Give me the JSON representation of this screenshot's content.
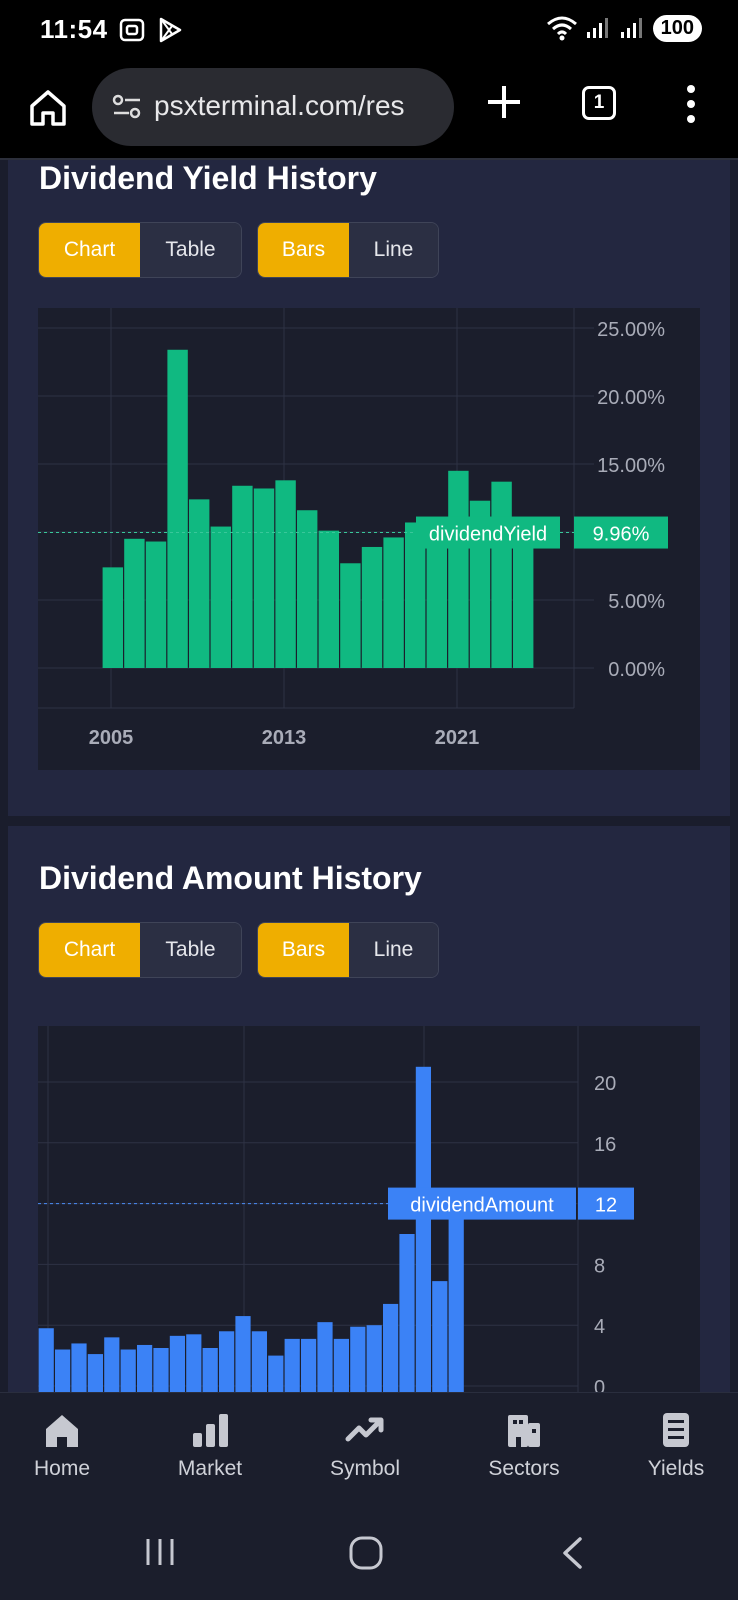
{
  "status": {
    "time": "11:54",
    "battery": "100"
  },
  "browser": {
    "url": "psxterminal.com/res",
    "tab_count": "1"
  },
  "yield_section": {
    "title": "Dividend Yield History",
    "view_toggle": [
      "Chart",
      "Table"
    ],
    "view_active": "Chart",
    "style_toggle": [
      "Bars",
      "Line"
    ],
    "style_active": "Bars"
  },
  "amount_section": {
    "title": "Dividend Amount History",
    "view_toggle": [
      "Chart",
      "Table"
    ],
    "view_active": "Chart",
    "style_toggle": [
      "Bars",
      "Line"
    ],
    "style_active": "Bars"
  },
  "chart_data": [
    {
      "type": "bar",
      "series_name": "dividendYield",
      "color": "#10b981",
      "x_ticks": [
        "2005",
        "2013",
        "2021"
      ],
      "y_ticks": [
        "0.00%",
        "5.00%",
        "10.00%",
        "15.00%",
        "20.00%",
        "25.00%"
      ],
      "ylim": [
        -3,
        26.5
      ],
      "values": [
        7.4,
        9.5,
        9.3,
        23.4,
        12.4,
        10.4,
        13.4,
        13.2,
        13.8,
        11.6,
        10.1,
        7.7,
        8.9,
        9.6,
        10.7,
        9.9,
        14.5,
        12.3,
        13.7,
        9.96
      ],
      "crosshair": {
        "label": "dividendYield",
        "value": "9.96%",
        "y": 9.96
      },
      "grid": true,
      "dashed_marker_color": "#17b58a"
    },
    {
      "type": "bar",
      "series_name": "dividendAmount",
      "color": "#3b82f6",
      "y_ticks": [
        "0",
        "4",
        "8",
        "12",
        "16",
        "20"
      ],
      "ylim": [
        0,
        24
      ],
      "values": [
        3.8,
        2.4,
        2.8,
        2.1,
        3.2,
        2.4,
        2.7,
        2.5,
        3.3,
        3.4,
        2.5,
        3.6,
        4.6,
        3.6,
        2.0,
        3.1,
        3.1,
        4.2,
        3.1,
        3.9,
        4.0,
        5.4,
        10.0,
        21.0,
        6.9,
        12.0
      ],
      "crosshair": {
        "label": "dividendAmount",
        "value": "12",
        "y": 12
      },
      "grid": true
    }
  ],
  "bottom_nav": [
    {
      "label": "Home",
      "icon": "home-icon"
    },
    {
      "label": "Market",
      "icon": "bar-chart-icon"
    },
    {
      "label": "Symbol",
      "icon": "trending-up-icon"
    },
    {
      "label": "Sectors",
      "icon": "building-icon"
    },
    {
      "label": "Yields",
      "icon": "document-icon"
    }
  ]
}
